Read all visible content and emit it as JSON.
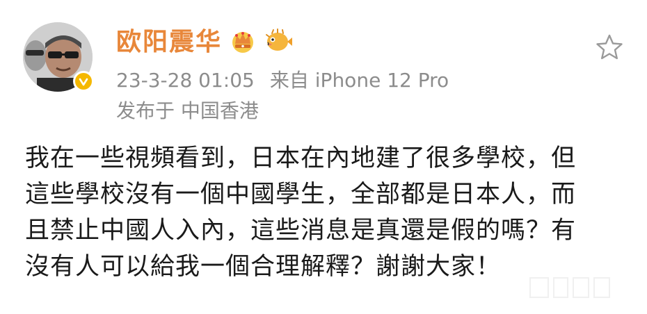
{
  "post": {
    "author": {
      "name": "欧阳震华",
      "verified": true
    },
    "timestamp": "23-3-28 01:05",
    "source": "来自 iPhone 12 Pro",
    "location": "发布于 中国香港",
    "content_lines": [
      "我在一些視頻看到，日本在內地建了很多學校，但",
      "這些學校沒有一個中國學生，全部都是日本人，而",
      "且禁止中國人入內，這些消息是真還是假的嗎？有",
      "沒有人可以給我一個合理解釋？謝謝大家！"
    ]
  },
  "icons": {
    "crown": "crown-icon",
    "pufferfish": "pufferfish-icon",
    "star": "star-icon",
    "verified": "verified-badge-icon"
  },
  "colors": {
    "username": "#e8873a",
    "meta": "#8c8c8c",
    "text": "#1a1a1a",
    "verified": "#f5b800"
  }
}
